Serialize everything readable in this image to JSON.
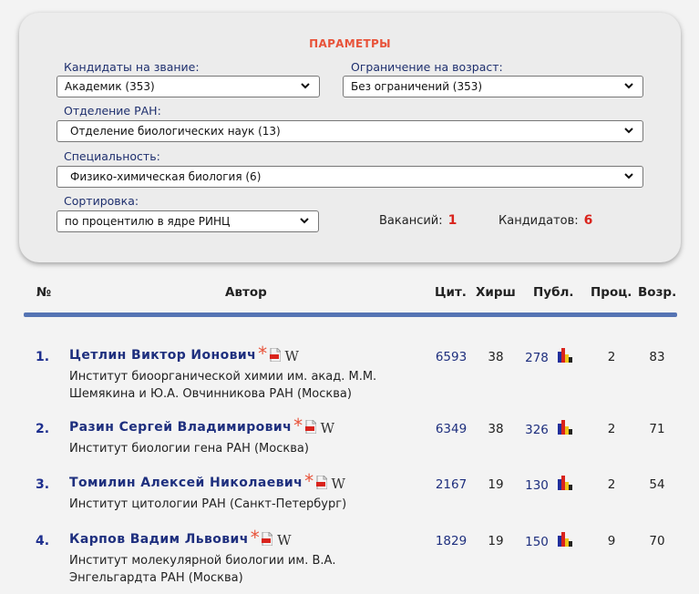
{
  "params": {
    "title": "ПАРАМЕТРЫ",
    "rank_label": "Кандидаты на звание:",
    "rank_value": "Академик  (353)",
    "age_label": "Ограничение на возраст:",
    "age_value": "Без ограничений  (353)",
    "dept_label": "Отделение РАН:",
    "dept_value": "Отделение биологических наук  (13)",
    "spec_label": "Специальность:",
    "spec_value": "Физико-химическая биология  (6)",
    "sort_label": "Сортировка:",
    "sort_value": "по процентилю в ядре РИНЦ",
    "vacancies_label": "Вакансий:",
    "vacancies_value": "1",
    "candidates_label": "Кандидатов:",
    "candidates_value": "6"
  },
  "table": {
    "headers": [
      "№",
      "Автор",
      "Цит.",
      "Хирш",
      "Публ.",
      "Проц.",
      "Возр."
    ],
    "rows": [
      {
        "num": "1.",
        "name": "Цетлин Виктор Ионович",
        "inst": "Институт биоорганической химии им. акад. М.М. Шемякина и Ю.А. Овчинникова РАН (Москва)",
        "cit": "6593",
        "h": "38",
        "pub": "278",
        "proc": "2",
        "age": "83"
      },
      {
        "num": "2.",
        "name": "Разин Сергей Владимирович",
        "inst": "Институт биологии гена РАН (Москва)",
        "cit": "6349",
        "h": "38",
        "pub": "326",
        "proc": "2",
        "age": "71"
      },
      {
        "num": "3.",
        "name": "Томилин Алексей Николаевич",
        "inst": "Институт цитологии РАН (Санкт-Петербург)",
        "cit": "2167",
        "h": "19",
        "pub": "130",
        "proc": "2",
        "age": "54"
      },
      {
        "num": "4.",
        "name": "Карпов Вадим Львович",
        "inst": "Институт молекулярной биологии им. В.А. Энгельгардта РАН (Москва)",
        "cit": "1829",
        "h": "19",
        "pub": "150",
        "proc": "9",
        "age": "70"
      }
    ]
  },
  "icons": {
    "star": "*",
    "wiki": "W",
    "dropdown": "chevron-down-icon",
    "pdf": "pdf-icon",
    "bars": "bar-chart-icon"
  },
  "colors": {
    "accent": "#e8533a",
    "link": "#1e2f7e",
    "rule": "#5574b3",
    "number_red": "#d9231c"
  }
}
